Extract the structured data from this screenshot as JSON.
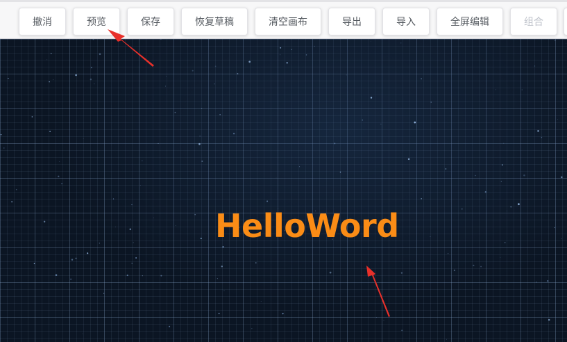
{
  "toolbar": {
    "buttons": [
      {
        "label": "撤消",
        "disabled": false
      },
      {
        "label": "预览",
        "disabled": false
      },
      {
        "label": "保存",
        "disabled": false
      },
      {
        "label": "恢复草稿",
        "disabled": false
      },
      {
        "label": "清空画布",
        "disabled": false
      },
      {
        "label": "导出",
        "disabled": false
      },
      {
        "label": "导入",
        "disabled": false
      },
      {
        "label": "全屏编辑",
        "disabled": false
      },
      {
        "label": "组合",
        "disabled": true
      }
    ]
  },
  "canvas": {
    "text": "HelloWord",
    "text_color": "#fa8c16",
    "background_color": "#0b1523"
  },
  "annotations": {
    "arrow_color": "#e8302a"
  }
}
